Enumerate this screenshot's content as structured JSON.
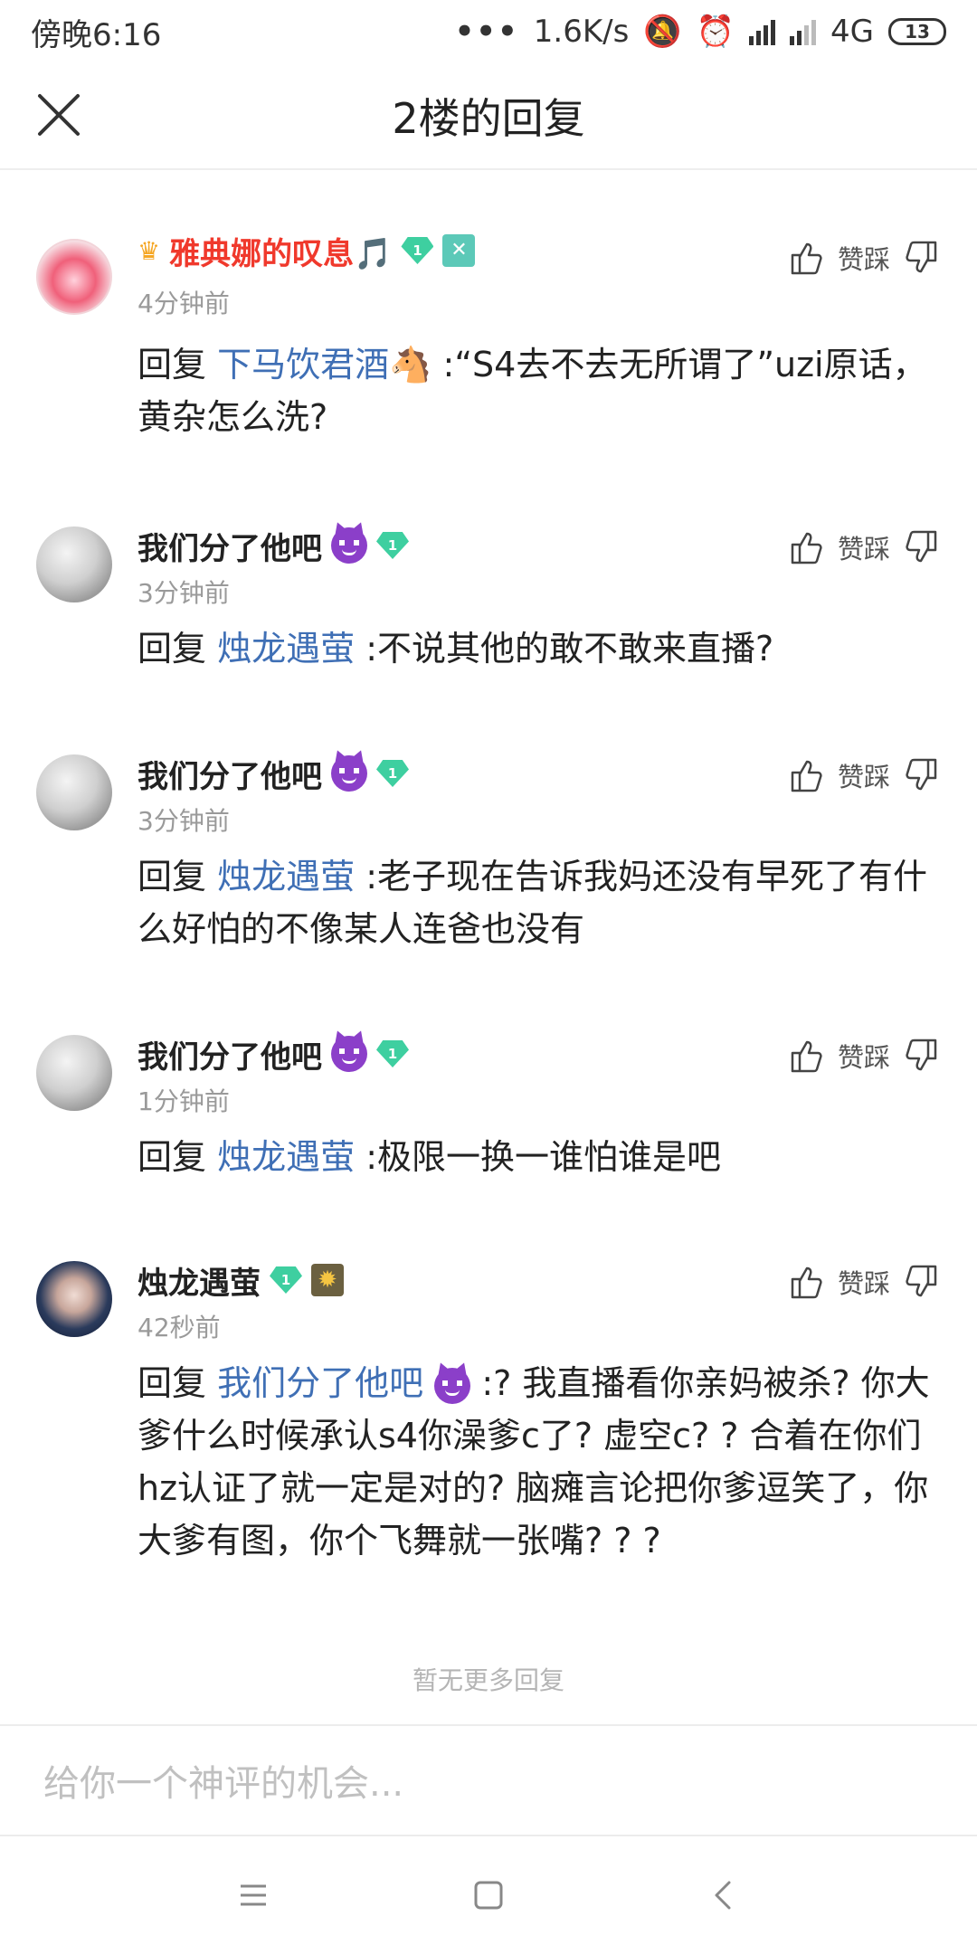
{
  "status": {
    "time": "傍晚6:16",
    "dots": "•••",
    "speed": "1.6K/s",
    "network": "4G",
    "battery": "13"
  },
  "header": {
    "title": "2楼的回复"
  },
  "action_label": "赞踩",
  "reply_prefix": "回复",
  "comments": [
    {
      "username": "雅典娜的叹息🎵",
      "time": "4分钟前",
      "mention": "下马饮君酒🐴",
      "text": ":“S4去不去无所谓了”uzi原话，黄杂怎么洗?"
    },
    {
      "username": "我们分了他吧",
      "time": "3分钟前",
      "mention": "烛龙遇萤",
      "text": ":不说其他的敢不敢来直播?"
    },
    {
      "username": "我们分了他吧",
      "time": "3分钟前",
      "mention": "烛龙遇萤",
      "text": ":老子现在告诉我妈还没有早死了有什么好怕的不像某人连爸也没有"
    },
    {
      "username": "我们分了他吧",
      "time": "1分钟前",
      "mention": "烛龙遇萤",
      "text": ":极限一换一谁怕谁是吧"
    },
    {
      "username": "烛龙遇萤",
      "time": "42秒前",
      "mention": "我们分了他吧",
      "text": ":? 我直播看你亲妈被杀? 你大爹什么时候承认s4你澡爹c了? 虚空c? ? 合着在你们hz认证了就一定是对的? 脑瘫言论把你爹逗笑了，你大爹有图，你个飞舞就一张嘴? ? ?"
    }
  ],
  "level_badge": "1",
  "no_more": "暂无更多回复",
  "input": {
    "placeholder": "给你一个神评的机会..."
  }
}
